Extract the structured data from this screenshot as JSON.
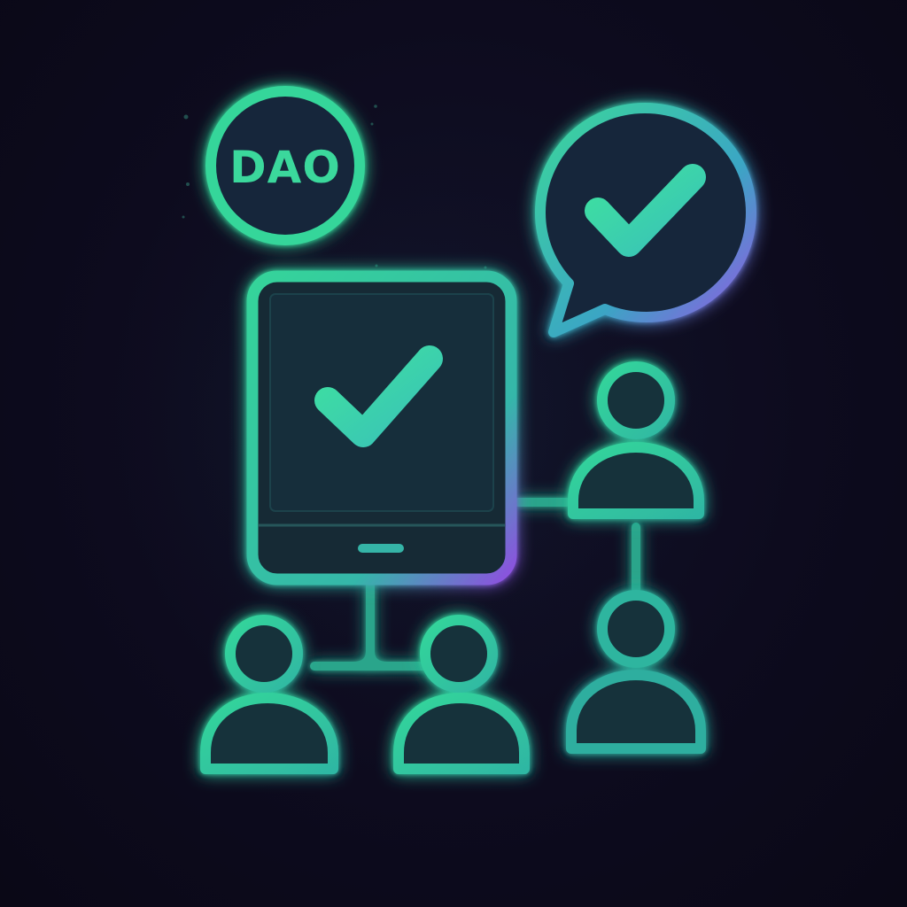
{
  "badge": {
    "text": "DAO",
    "icon": "dao-coin-icon"
  },
  "icons": {
    "tablet": "tablet-checkmark-icon",
    "speech_bubble": "speech-bubble-checkmark-icon",
    "member": "person-icon",
    "connector": "network-line"
  },
  "colors": {
    "background": "#0c0a1c",
    "accent_green": "#2fd89a",
    "accent_teal": "#3cc7b0",
    "accent_purple": "#8b4fe0",
    "glyph_fill": "#12303a"
  },
  "members": [
    "member-1",
    "member-2",
    "member-3",
    "member-4"
  ]
}
